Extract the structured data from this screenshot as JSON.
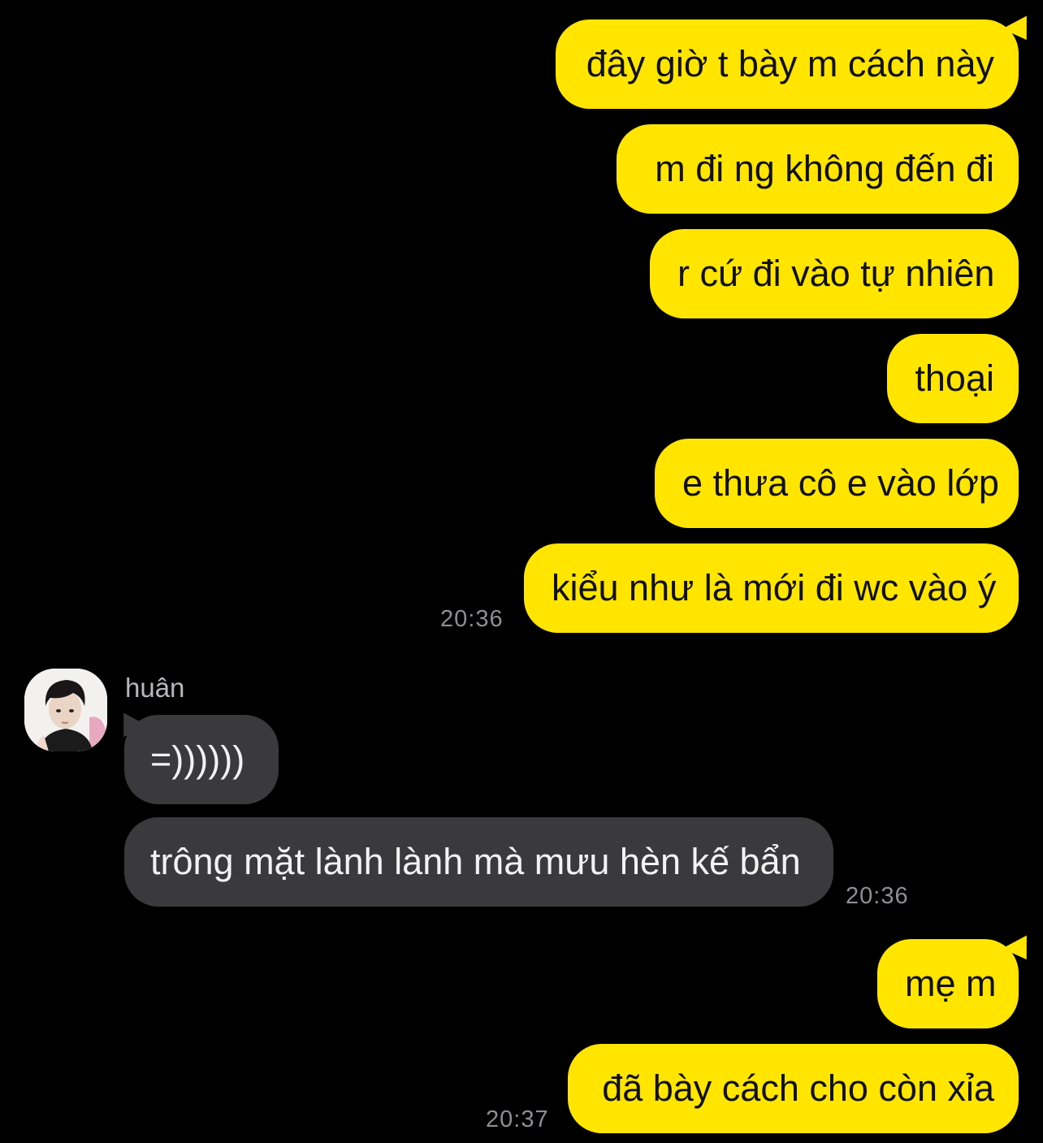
{
  "messages": {
    "out_group_1": [
      "đây giờ t bày m cách này",
      "m đi ng không đến đi",
      "r cứ đi vào tự nhiên",
      "thoại",
      "e thưa cô e vào lớp",
      "kiểu như là mới đi wc vào ý"
    ],
    "out_group_1_time": "20:36",
    "in_sender": "huân",
    "in_group": [
      "=))))))",
      "trông mặt lành lành mà mưu hèn kế bẩn"
    ],
    "in_group_time": "20:36",
    "out_group_2": [
      "mẹ m",
      "đã bày cách cho còn xỉa"
    ],
    "out_group_2_time": "20:37"
  },
  "colors": {
    "background": "#000000",
    "outgoing_bubble": "#FFE500",
    "incoming_bubble": "#3A3A3C",
    "timestamp": "#8E8E93"
  }
}
